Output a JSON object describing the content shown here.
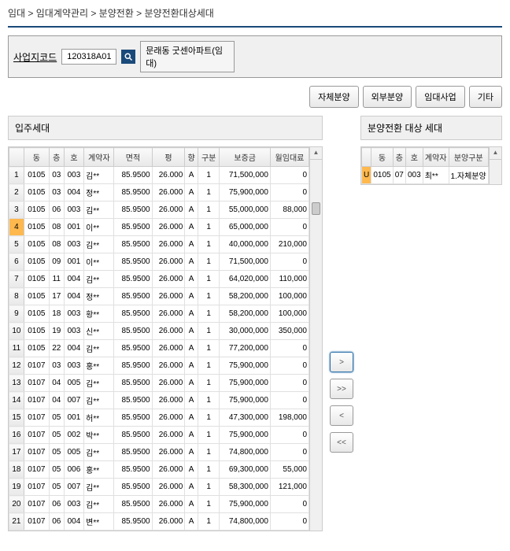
{
  "breadcrumb": "임대 > 임대계약관리 > 분양전환 > 분양전환대상세대",
  "search": {
    "label": "사업지코드",
    "code": "120318A01",
    "result": "문래동 굿센아파트(임대)"
  },
  "actions": {
    "b1": "자체분양",
    "b2": "외부분양",
    "b3": "임대사업",
    "b4": "기타"
  },
  "left": {
    "title": "입주세대",
    "headers": [
      "동",
      "층",
      "호",
      "계약자",
      "면적",
      "평",
      "향",
      "구분",
      "보증금",
      "월임대료"
    ],
    "rows": [
      {
        "n": "1",
        "d": [
          "0105",
          "03",
          "003",
          "김**",
          "85.9500",
          "26.000",
          "A",
          "1",
          "71,500,000",
          "0"
        ]
      },
      {
        "n": "2",
        "d": [
          "0105",
          "03",
          "004",
          "정**",
          "85.9500",
          "26.000",
          "A",
          "1",
          "75,900,000",
          "0"
        ]
      },
      {
        "n": "3",
        "d": [
          "0105",
          "06",
          "003",
          "김**",
          "85.9500",
          "26.000",
          "A",
          "1",
          "55,000,000",
          "88,000"
        ]
      },
      {
        "n": "4",
        "hl": true,
        "d": [
          "0105",
          "08",
          "001",
          "이**",
          "85.9500",
          "26.000",
          "A",
          "1",
          "65,000,000",
          "0"
        ]
      },
      {
        "n": "5",
        "d": [
          "0105",
          "08",
          "003",
          "김**",
          "85.9500",
          "26.000",
          "A",
          "1",
          "40,000,000",
          "210,000"
        ]
      },
      {
        "n": "6",
        "d": [
          "0105",
          "09",
          "001",
          "이**",
          "85.9500",
          "26.000",
          "A",
          "1",
          "71,500,000",
          "0"
        ]
      },
      {
        "n": "7",
        "d": [
          "0105",
          "11",
          "004",
          "김**",
          "85.9500",
          "26.000",
          "A",
          "1",
          "64,020,000",
          "110,000"
        ]
      },
      {
        "n": "8",
        "d": [
          "0105",
          "17",
          "004",
          "정**",
          "85.9500",
          "26.000",
          "A",
          "1",
          "58,200,000",
          "100,000"
        ]
      },
      {
        "n": "9",
        "d": [
          "0105",
          "18",
          "003",
          "황**",
          "85.9500",
          "26.000",
          "A",
          "1",
          "58,200,000",
          "100,000"
        ]
      },
      {
        "n": "10",
        "d": [
          "0105",
          "19",
          "003",
          "신**",
          "85.9500",
          "26.000",
          "A",
          "1",
          "30,000,000",
          "350,000"
        ]
      },
      {
        "n": "11",
        "d": [
          "0105",
          "22",
          "004",
          "김**",
          "85.9500",
          "26.000",
          "A",
          "1",
          "77,200,000",
          "0"
        ]
      },
      {
        "n": "12",
        "d": [
          "0107",
          "03",
          "003",
          "홍**",
          "85.9500",
          "26.000",
          "A",
          "1",
          "75,900,000",
          "0"
        ]
      },
      {
        "n": "13",
        "d": [
          "0107",
          "04",
          "005",
          "김**",
          "85.9500",
          "26.000",
          "A",
          "1",
          "75,900,000",
          "0"
        ]
      },
      {
        "n": "14",
        "d": [
          "0107",
          "04",
          "007",
          "김**",
          "85.9500",
          "26.000",
          "A",
          "1",
          "75,900,000",
          "0"
        ]
      },
      {
        "n": "15",
        "d": [
          "0107",
          "05",
          "001",
          "허**",
          "85.9500",
          "26.000",
          "A",
          "1",
          "47,300,000",
          "198,000"
        ]
      },
      {
        "n": "16",
        "d": [
          "0107",
          "05",
          "002",
          "박**",
          "85.9500",
          "26.000",
          "A",
          "1",
          "75,900,000",
          "0"
        ]
      },
      {
        "n": "17",
        "d": [
          "0107",
          "05",
          "005",
          "김**",
          "85.9500",
          "26.000",
          "A",
          "1",
          "74,800,000",
          "0"
        ]
      },
      {
        "n": "18",
        "d": [
          "0107",
          "05",
          "006",
          "홍**",
          "85.9500",
          "26.000",
          "A",
          "1",
          "69,300,000",
          "55,000"
        ]
      },
      {
        "n": "19",
        "d": [
          "0107",
          "05",
          "007",
          "김**",
          "85.9500",
          "26.000",
          "A",
          "1",
          "58,300,000",
          "121,000"
        ]
      },
      {
        "n": "20",
        "d": [
          "0107",
          "06",
          "003",
          "김**",
          "85.9500",
          "26.000",
          "A",
          "1",
          "75,900,000",
          "0"
        ]
      },
      {
        "n": "21",
        "d": [
          "0107",
          "06",
          "004",
          "변**",
          "85.9500",
          "26.000",
          "A",
          "1",
          "74,800,000",
          "0"
        ]
      }
    ]
  },
  "right": {
    "title": "분양전환 대상 세대",
    "headers": [
      "동",
      "층",
      "호",
      "계약자",
      "분양구분"
    ],
    "rows": [
      {
        "s": "U",
        "d": [
          "0105",
          "07",
          "003",
          "최**",
          "1.자체분양"
        ]
      }
    ]
  },
  "transfer": {
    "r1": ">",
    "r2": ">>",
    "r3": "<",
    "r4": "<<"
  }
}
